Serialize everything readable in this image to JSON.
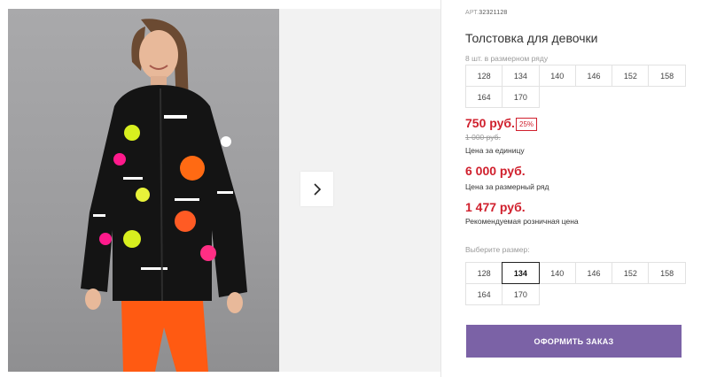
{
  "product": {
    "art_label": "АРТ.",
    "art_number": "32321128",
    "title": "Толстовка для девочки",
    "size_range_hint": "8 шт. в размерном ряду",
    "size_range": [
      "128",
      "134",
      "140",
      "146",
      "152",
      "158",
      "164",
      "170"
    ]
  },
  "pricing": {
    "unit_price": "750 руб.",
    "discount": "25%",
    "old_price": "1 000 руб.",
    "unit_price_label": "Цена за единицу",
    "range_price": "6 000 руб.",
    "range_price_label": "Цена за размерный ряд",
    "retail_price": "1 477 руб.",
    "retail_price_label": "Рекомендуемая розничная цена"
  },
  "size_select": {
    "label": "Выберите размер:",
    "options": [
      "128",
      "134",
      "140",
      "146",
      "152",
      "158",
      "164",
      "170"
    ],
    "selected": "134"
  },
  "order_button": "ОФОРМИТЬ ЗАКАЗ",
  "gallery": {
    "next_icon": "chevron-right-icon"
  },
  "colors": {
    "price_red": "#d0202d",
    "button_purple": "#7b62a6"
  }
}
